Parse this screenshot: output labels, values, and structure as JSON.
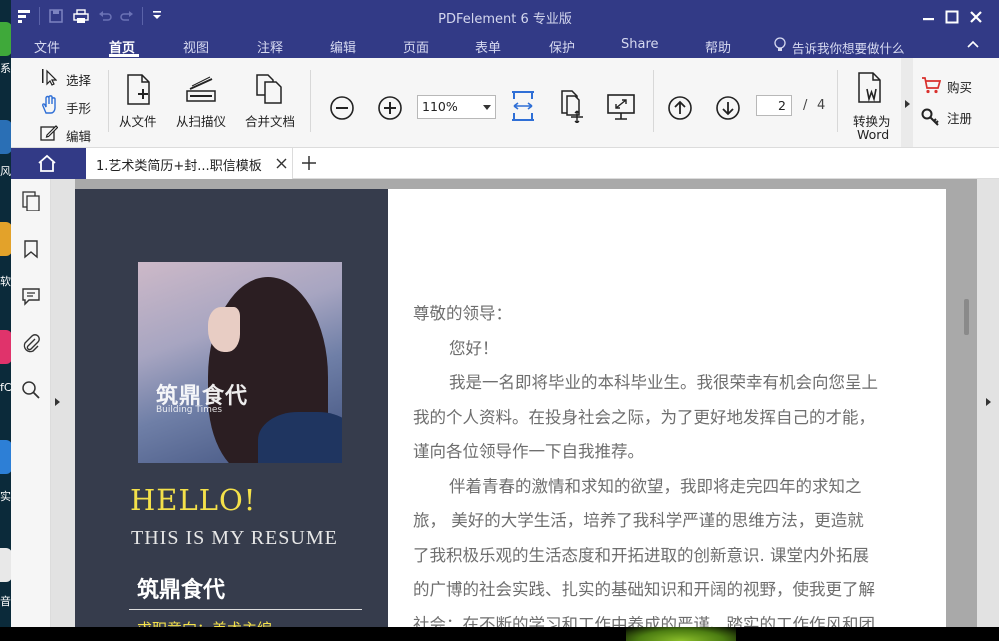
{
  "app": {
    "title": "PDFelement  6  专业版",
    "colors": {
      "titlebar": "#323a86",
      "accent_yellow": "#f4e14a",
      "resume_panel": "#363c4c"
    }
  },
  "desktop_strip": {
    "labels": [
      "系",
      "风",
      "软",
      "fC",
      "实",
      "音"
    ]
  },
  "quick_access": {
    "icons": [
      "app-menu-icon",
      "save-icon",
      "print-icon",
      "undo-icon",
      "redo-icon",
      "customize-icon"
    ]
  },
  "menu": {
    "items": [
      "文件",
      "首页",
      "视图",
      "注释",
      "编辑",
      "页面",
      "表单",
      "保护",
      "Share",
      "帮助"
    ],
    "active": "首页",
    "tell_me": "告诉我你想要做什么"
  },
  "ribbon": {
    "select": "选择",
    "hand": "手形",
    "edit": "编辑",
    "from_file": "从文件",
    "from_scanner": "从扫描仪",
    "merge": "合并文档",
    "zoom": "110%",
    "page_current": "2",
    "page_separator": "/",
    "page_total": "4",
    "to_word_line1": "转换为",
    "to_word_line2": "Word",
    "buy": "购买",
    "register": "注册"
  },
  "tabs": {
    "document": "1.艺术类简历+封...职信模板"
  },
  "resume": {
    "photo_brand": "筑鼎食代",
    "photo_brand_sub": "Building Times",
    "hello": "HELLO!",
    "subtitle": "THIS IS MY RESUME",
    "name": "筑鼎食代",
    "job_intent": "求职意向：美术主编"
  },
  "letter": {
    "lines": [
      "尊敬的领导：",
      "您好！",
      "我是一名即将毕业的本科毕业生。我很荣幸有机会向您呈上",
      "我的个人资料。在投身社会之际，为了更好地发挥自己的才能，",
      "谨向各位领导作一下自我推荐。",
      "伴着青春的激情和求知的欲望，我即将走完四年的求知之",
      "旅，  美好的大学生活，培养了我科学严谨的思维方法，更造就",
      "了我积极乐观的生活态度和开拓进取的创新意识. 课堂内外拓展",
      "的广博的社会实践、扎实的基础知识和开阔的视野，使我更了解",
      "社会；在不断的学习和工作中养成的严谨、踏实的工作作风和团"
    ]
  }
}
